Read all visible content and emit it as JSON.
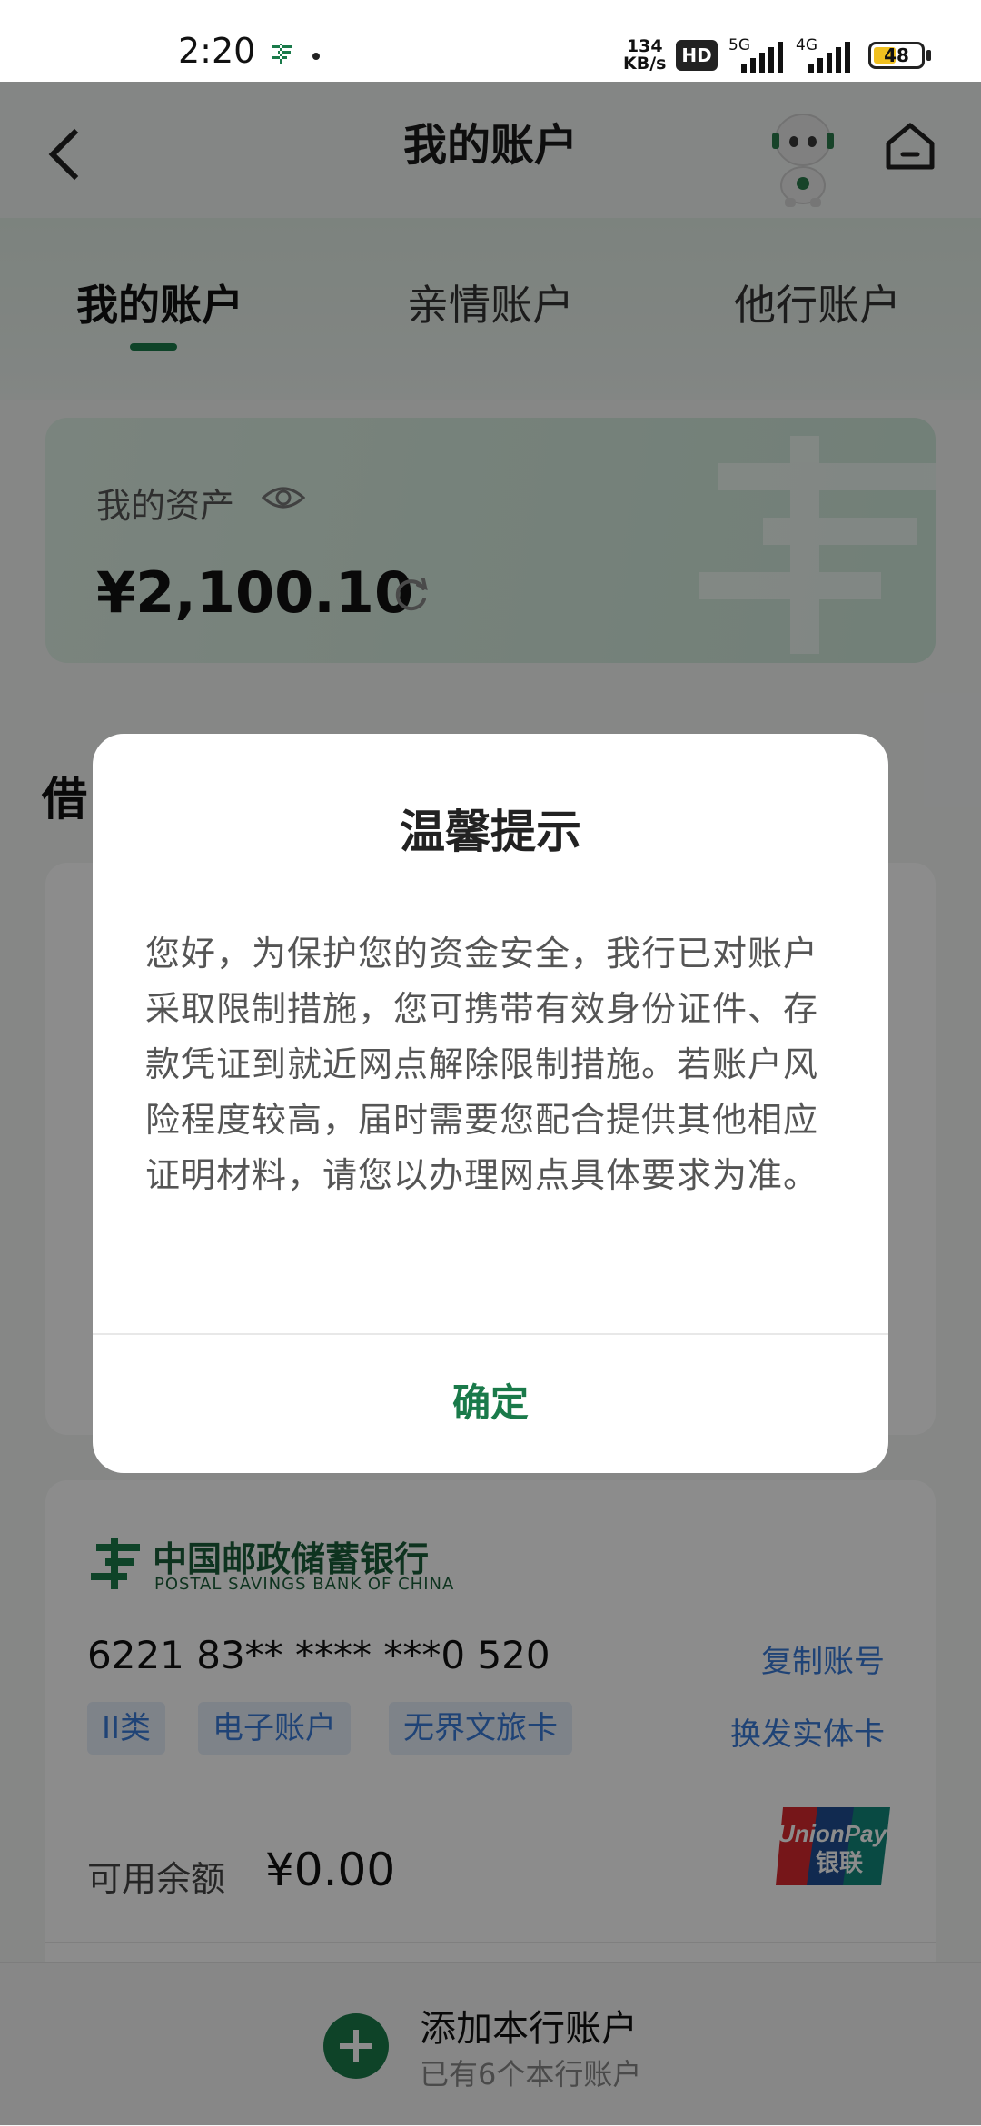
{
  "status_bar": {
    "time": "2:20",
    "net_speed_value": "134",
    "net_speed_unit": "KB/s",
    "hd_badge": "HD",
    "signal_5g": "5G",
    "signal_4g": "4G",
    "battery": "48",
    "battery_level": 0.48
  },
  "header": {
    "title": "我的账户",
    "back_icon": "chevron-left-icon",
    "home_icon": "home-icon",
    "mascot": "robot-mascot"
  },
  "tabs": [
    {
      "label": "我的账户",
      "active": true
    },
    {
      "label": "亲情账户",
      "active": false
    },
    {
      "label": "他行账户",
      "active": false
    }
  ],
  "assets": {
    "label": "我的资产",
    "amount": "¥2,100.10"
  },
  "section": {
    "title_visible": "借"
  },
  "account_card": {
    "bank_name": "中国邮政储蓄银行",
    "bank_name_en": "POSTAL SAVINGS BANK OF CHINA",
    "account_number": "6221 83** **** ***0 520",
    "copy_label": "复制账号",
    "reissue_label": "换发实体卡",
    "tags": [
      "II类",
      "电子账户",
      "无界文旅卡"
    ],
    "balance_label": "可用余额",
    "balance_value": "¥0.00",
    "card_network": "UnionPay 银联"
  },
  "bottom_bar": {
    "add_label": "添加本行账户",
    "add_sub": "已有6个本行账户"
  },
  "dialog": {
    "title": "温馨提示",
    "body": "您好，为保护您的资金安全，我行已对账户采取限制措施，您可携带有效身份证件、存款凭证到就近网点解除限制措施。若账户风险程度较高，届时需要您配合提供其他相应证明材料，请您以办理网点具体要求为准。",
    "confirm_label": "确定"
  },
  "colors": {
    "brand_green": "#1a7a4a",
    "link_blue": "#3a7ad8",
    "battery_yellow": "#f0c020"
  }
}
